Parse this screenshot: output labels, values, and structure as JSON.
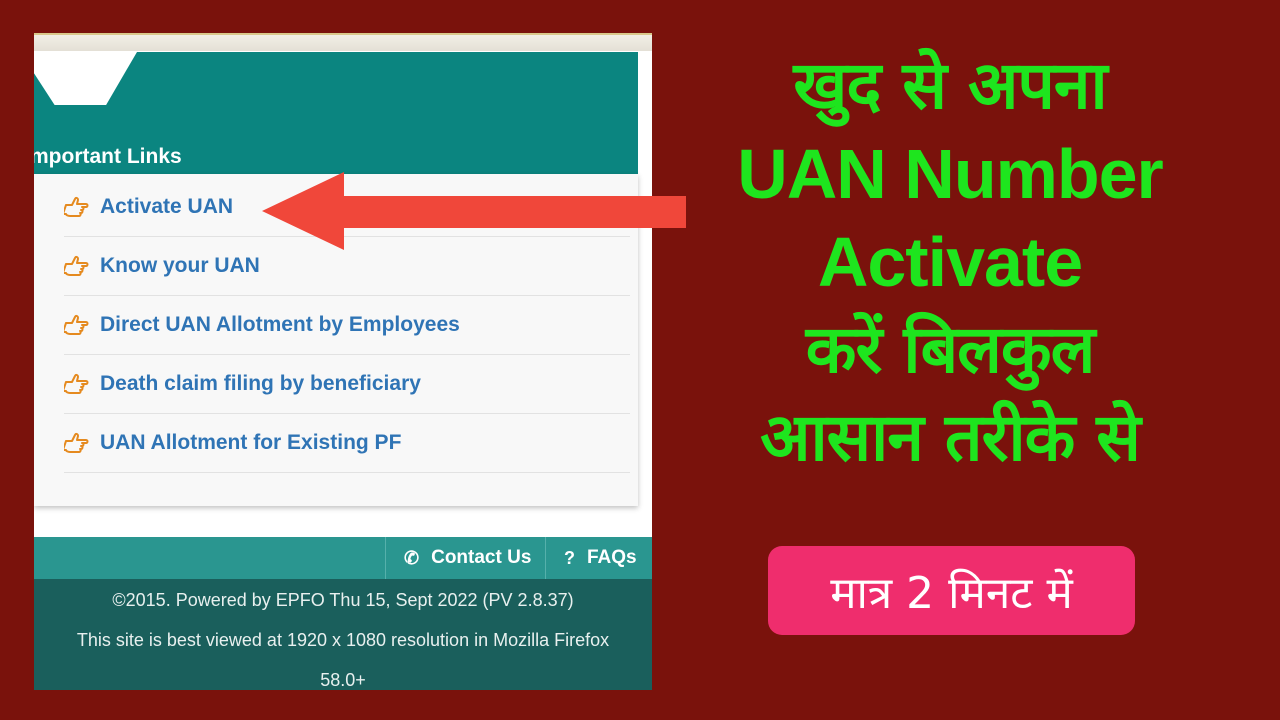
{
  "links_panel": {
    "title": "mportant Links",
    "items": [
      {
        "label": "Activate UAN"
      },
      {
        "label": "Know your UAN"
      },
      {
        "label": "Direct UAN Allotment by Employees"
      },
      {
        "label": "Death claim filing by beneficiary"
      },
      {
        "label": "UAN Allotment for Existing PF"
      }
    ]
  },
  "footer": {
    "contact_label": "Contact Us",
    "faq_label": "FAQs",
    "copyright": "©2015. Powered by EPFO Thu 15, Sept 2022 (PV 2.8.37)",
    "browser_note": "This site is best viewed at 1920 x 1080 resolution in Mozilla Firefox",
    "browser_version": "58.0+"
  },
  "headline": {
    "line1": "खुद से अपना",
    "line2": "UAN Number",
    "line3": "Activate",
    "line4": "करें बिलकुल",
    "line5": "आसान तरीके से"
  },
  "badge": {
    "text": "मात्र 2 मिनट में"
  },
  "icons": {
    "link_icon": "hand-pointing-right-icon",
    "contact_icon": "phone-icon",
    "faq_icon": "question-icon",
    "arrow": "left-arrow"
  },
  "colors": {
    "background": "#7a120c",
    "headline": "#1ee51e",
    "header_teal": "#0b8580",
    "link_blue": "#2f74b5",
    "icon_orange": "#e58a1f",
    "arrow_red": "#f0473a",
    "badge_pink": "#ef2d6d"
  }
}
